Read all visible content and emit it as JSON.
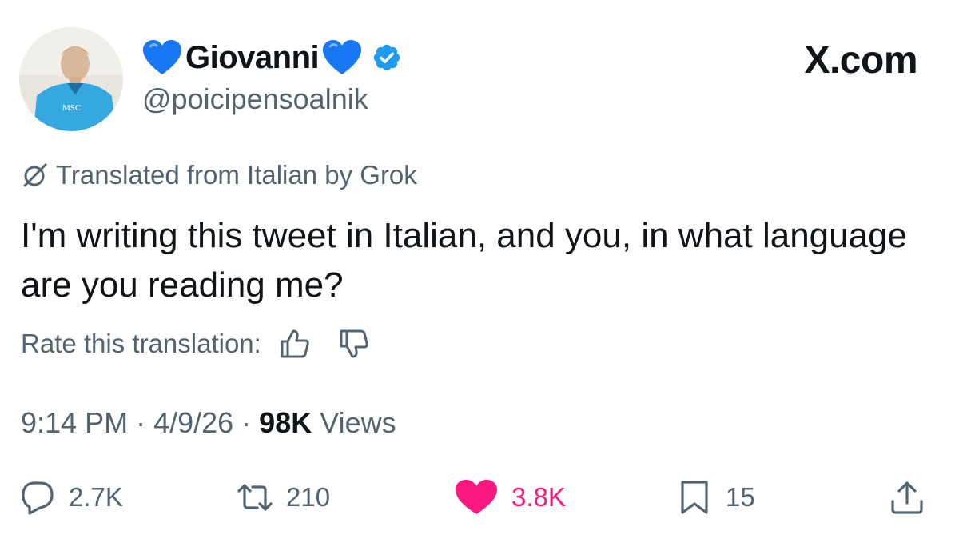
{
  "author": {
    "display_name": "Giovanni",
    "name_emoji": "blue-heart-icon",
    "verified": true,
    "handle": "@poicipensoalnik",
    "avatar_shirt_text": "MSC"
  },
  "site_logo": "X.com",
  "translation": {
    "notice": "Translated from Italian by Grok",
    "rate_label": "Rate this translation:"
  },
  "tweet": {
    "text": "I'm writing this tweet in Italian, and you, in what language are you reading me?"
  },
  "meta": {
    "time": "9:14 PM",
    "separator": "·",
    "date": "4/9/26",
    "views_count": "98K",
    "views_label": "Views"
  },
  "actions": {
    "replies": "2.7K",
    "reposts": "210",
    "likes": "3.8K",
    "bookmarks": "15"
  },
  "colors": {
    "text": "#0f1419",
    "secondary": "#536471",
    "verified_blue": "#1d9bf0",
    "heart_blue": "#1877f2",
    "like_pink": "#f91880"
  }
}
